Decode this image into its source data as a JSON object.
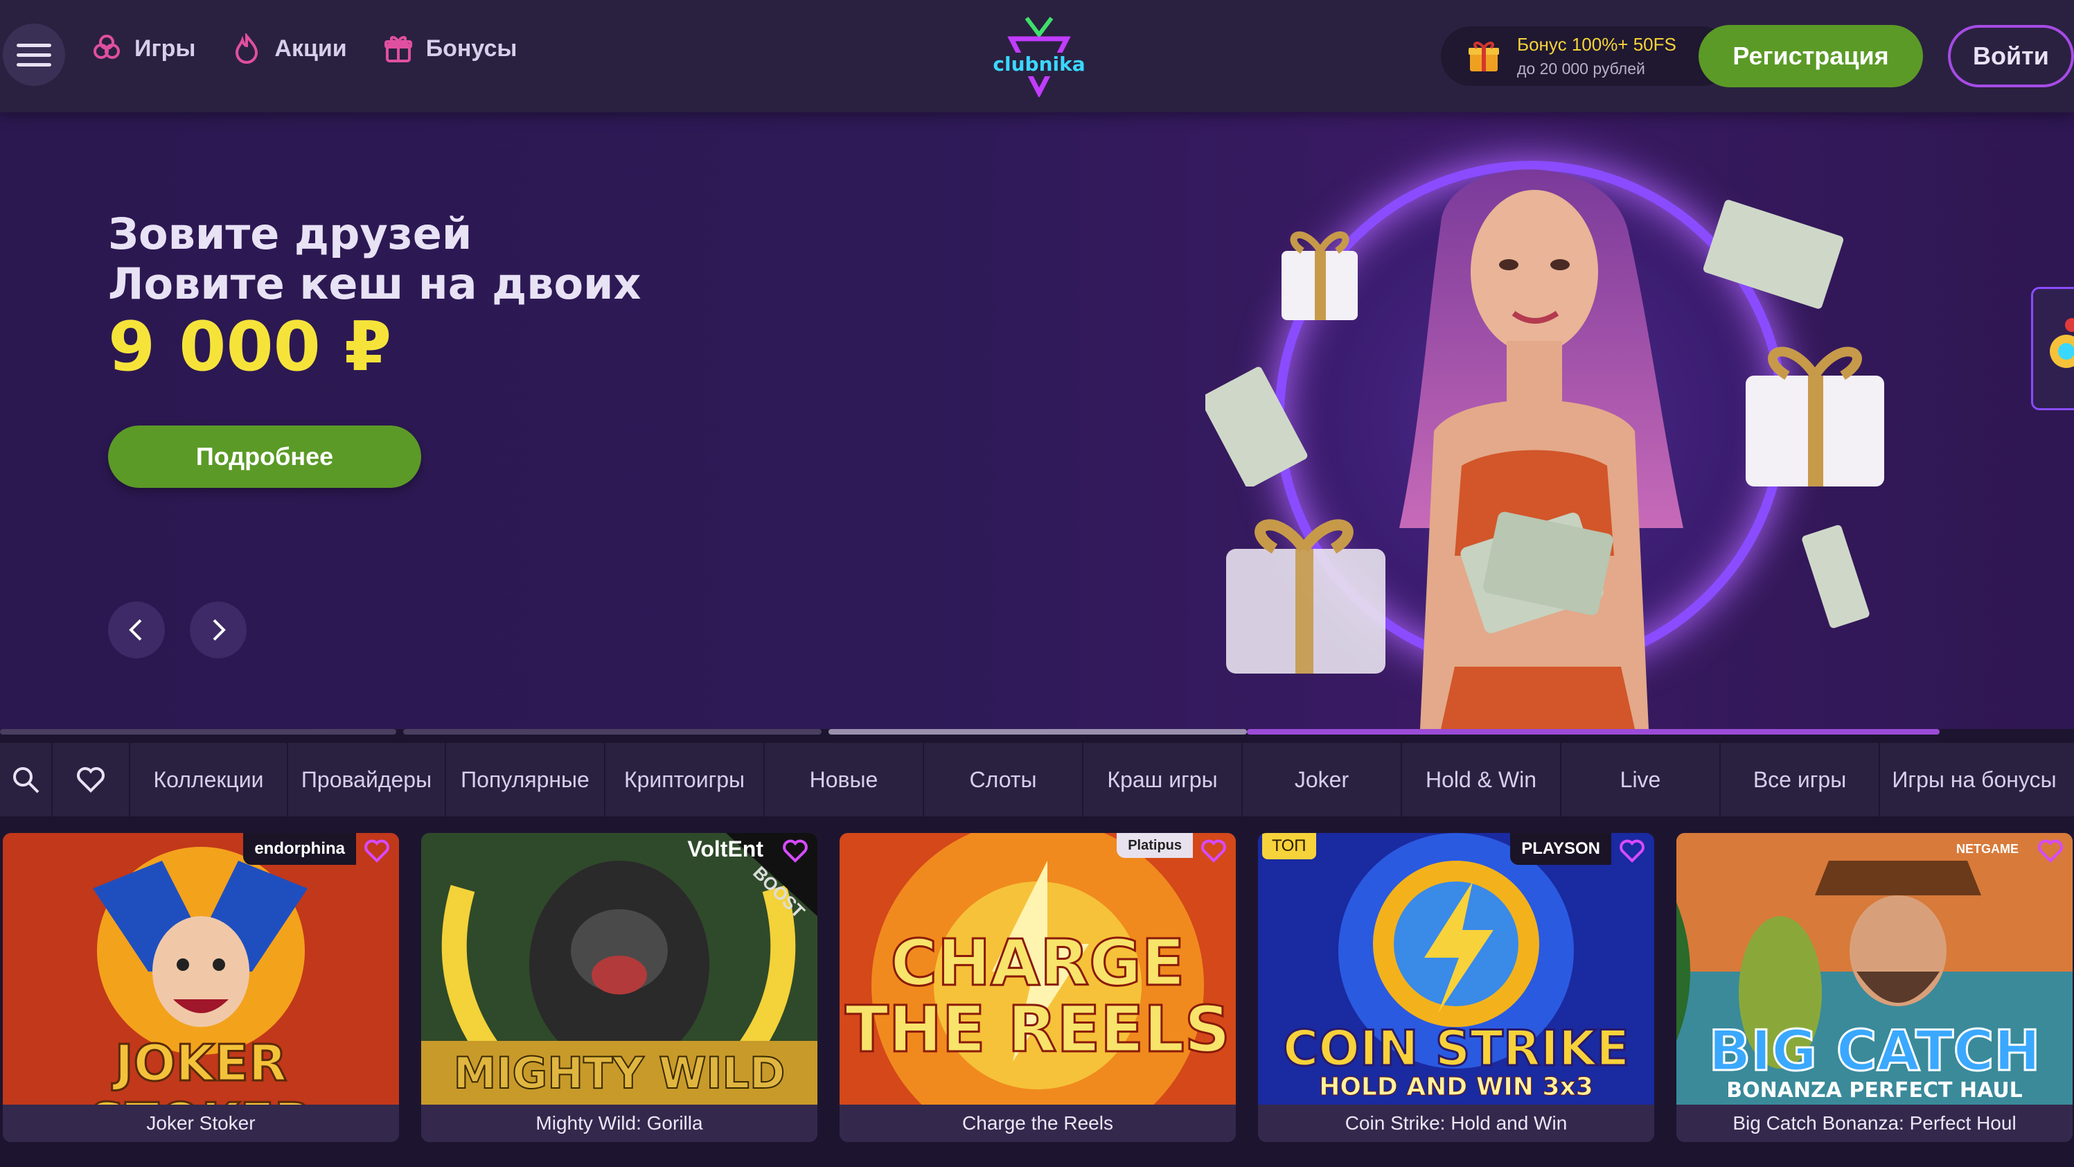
{
  "header": {
    "menu_icon": "hamburger-icon",
    "nav": [
      {
        "label": "Игры",
        "icon": "strawberry-icon"
      },
      {
        "label": "Акции",
        "icon": "fire-icon"
      },
      {
        "label": "Бонусы",
        "icon": "gift-icon"
      }
    ],
    "logo_text": "clubnika",
    "bonus": {
      "line1": "Бонус 100%+ 50FS",
      "line2": "до 20 000 рублей",
      "icon": "gift-icon"
    },
    "register_label": "Регистрация",
    "login_label": "Войти"
  },
  "hero": {
    "title_line1": "Зовите друзей",
    "title_line2": "Ловите кеш на двоих",
    "amount": "9 000 ₽",
    "cta_label": "Подробнее",
    "prev_icon": "chevron-left-icon",
    "next_icon": "chevron-right-icon",
    "slides_total": 4,
    "active_slide": 3
  },
  "categories": {
    "search_icon": "search-icon",
    "favorites_icon": "heart-icon",
    "items": [
      "Коллекции",
      "Провайдеры",
      "Популярные",
      "Криптоигры",
      "Новые",
      "Слоты",
      "Краш игры",
      "Joker",
      "Hold & Win",
      "Live",
      "Все игры",
      "Игры на бонусы"
    ]
  },
  "games": [
    {
      "name": "Joker Stoker",
      "provider": "endorphina",
      "art_text": "JOKER STOKER",
      "badge": ""
    },
    {
      "name": "Mighty Wild: Gorilla",
      "provider": "VoltEnt",
      "art_text": "MIGHTY WILD GORILLA",
      "ribbon": "BOOST",
      "badge": ""
    },
    {
      "name": "Charge the Reels",
      "provider": "Platipus",
      "art_text": "CHARGE THE REELS",
      "badge": ""
    },
    {
      "name": "Coin Strike: Hold and Win",
      "provider": "PLAYSON",
      "art_text": "COIN STRIKE",
      "art_sub": "HOLD AND WIN 3x3",
      "badge": "ТОП"
    },
    {
      "name": "Big Catch Bonanza: Perfect Houl",
      "provider": "NETGAME",
      "art_text": "BIG CATCH",
      "art_sub": "BONANZA PERFECT HAUL",
      "badge": ""
    }
  ],
  "colors": {
    "accent_green": "#5b9a27",
    "accent_purple": "#a64be6",
    "amount_yellow": "#f6e33a",
    "background": "#1d1530"
  }
}
